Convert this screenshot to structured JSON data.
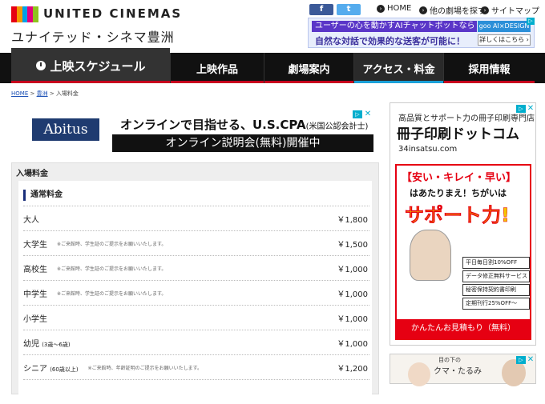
{
  "header": {
    "logo_text": "UNITED CINEMAS",
    "theater_name": "ユナイテッド・シネマ豊洲",
    "logo_colors": [
      "#e60012",
      "#f39800",
      "#00a0e9",
      "#e4007f",
      "#8fc31f"
    ],
    "social": {
      "facebook": "f",
      "twitter": "t"
    },
    "links": [
      {
        "label": "HOME",
        "icon": "home-icon"
      },
      {
        "label": "他の劇場を探す",
        "icon": "search-icon"
      },
      {
        "label": "サイトマップ",
        "icon": "sitemap-icon"
      }
    ],
    "banner": {
      "line1": "ユーザーの心を動かすAIチャットボットなら",
      "line2": "自然な対話で効果的な送客が可能に！",
      "brand": "goo AI×DESIGN",
      "button": "詳しくはこちら ›"
    }
  },
  "nav": {
    "items": [
      {
        "label": "上映スケジュール",
        "active": false
      },
      {
        "label": "上映作品",
        "active": false
      },
      {
        "label": "劇場案内",
        "active": false
      },
      {
        "label": "アクセス・料金",
        "active": true
      },
      {
        "label": "採用情報",
        "active": false
      }
    ]
  },
  "breadcrumb": {
    "items": [
      "HOME",
      "豊洲",
      "入場料金"
    ],
    "separator": ">"
  },
  "ad_main": {
    "brand": "Abitus",
    "line1": "オンラインで目指せる、U.S.CPA",
    "line1_small": "(米国公認会計士)",
    "line2": "オンライン説明会(無料)開催中",
    "ad_badge": "▷",
    "close": "✕"
  },
  "prices": {
    "panel_title": "入場料金",
    "section_title": "通常料金",
    "rows": [
      {
        "name": "大人",
        "sub": "",
        "note": "",
        "price": "￥1,800"
      },
      {
        "name": "大学生",
        "sub": "",
        "note": "※ご来館時、学生証のご提示をお願いいたします。",
        "price": "￥1,500"
      },
      {
        "name": "高校生",
        "sub": "",
        "note": "※ご来館時、学生証のご提示をお願いいたします。",
        "price": "￥1,000"
      },
      {
        "name": "中学生",
        "sub": "",
        "note": "※ご来館時、学生証のご提示をお願いいたします。",
        "price": "￥1,000"
      },
      {
        "name": "小学生",
        "sub": "",
        "note": "",
        "price": "￥1,000"
      },
      {
        "name": "幼児",
        "sub": "(3歳〜6歳)",
        "note": "",
        "price": "￥1,000"
      },
      {
        "name": "シニア",
        "sub": "(60歳以上)",
        "note": "※ご来館時、年齢証明のご提示をお願いいたします。",
        "price": "￥1,200"
      }
    ]
  },
  "side_ad": {
    "line1": "高品質とサポート力の冊子印刷専門店",
    "title": "冊子印刷ドットコム",
    "url": "34insatsu.com",
    "headline": "【安い・キレイ・早い】",
    "sub": "はあたりまえ！ちがいは",
    "big": "サポート力!",
    "features": [
      "平日毎日割10%OFF",
      "データ修正無料サービス",
      "秘密保持契約書印刷",
      "定期刊行25%OFF〜"
    ],
    "cta": "かんたんお見積もり（無料）"
  },
  "side_ad2": {
    "line1": "目の下の",
    "line2": "クマ・たるみ"
  }
}
